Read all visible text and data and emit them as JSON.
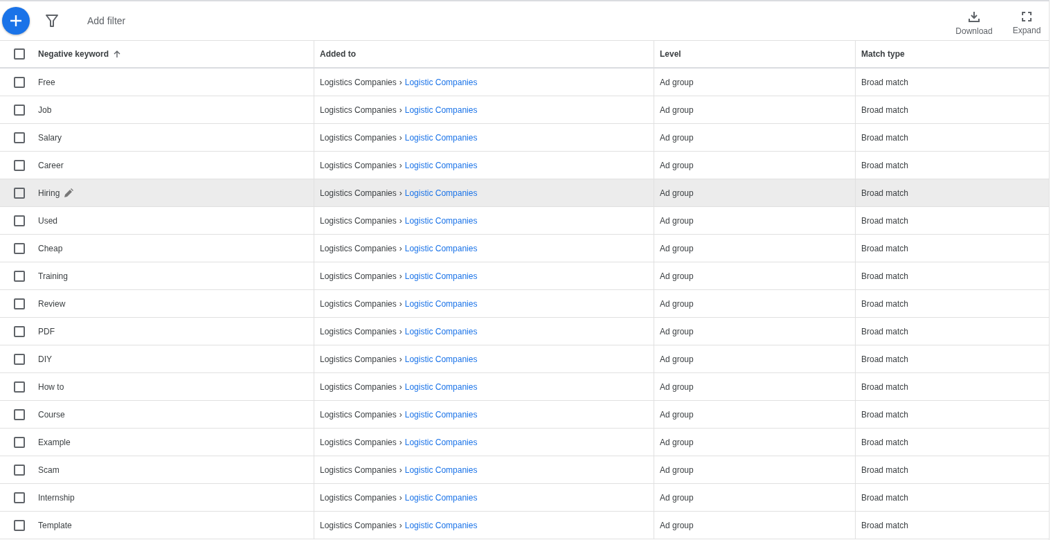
{
  "toolbar": {
    "add_filter": "Add filter",
    "actions": [
      {
        "kind": "download",
        "label": "Download"
      },
      {
        "kind": "expand",
        "label": "Expand"
      }
    ]
  },
  "table": {
    "columns": [
      {
        "label": "Negative keyword",
        "sorted": true
      },
      {
        "label": "Added to",
        "sorted": false
      },
      {
        "label": "Level",
        "sorted": false
      },
      {
        "label": "Match type",
        "sorted": false
      }
    ],
    "all_checked": false,
    "rows": [
      {
        "keyword": "Free",
        "campaign": "Logistics Companies",
        "separator": "›",
        "ad_group": "Logistic Companies",
        "level": "Ad group",
        "match_type": "Broad match",
        "checked": false,
        "hovered": false
      },
      {
        "keyword": "Job",
        "campaign": "Logistics Companies",
        "separator": "›",
        "ad_group": "Logistic Companies",
        "level": "Ad group",
        "match_type": "Broad match",
        "checked": false,
        "hovered": false
      },
      {
        "keyword": "Salary",
        "campaign": "Logistics Companies",
        "separator": "›",
        "ad_group": "Logistic Companies",
        "level": "Ad group",
        "match_type": "Broad match",
        "checked": false,
        "hovered": false
      },
      {
        "keyword": "Career",
        "campaign": "Logistics Companies",
        "separator": "›",
        "ad_group": "Logistic Companies",
        "level": "Ad group",
        "match_type": "Broad match",
        "checked": false,
        "hovered": false
      },
      {
        "keyword": "Hiring",
        "campaign": "Logistics Companies",
        "separator": "›",
        "ad_group": "Logistic Companies",
        "level": "Ad group",
        "match_type": "Broad match",
        "checked": false,
        "hovered": true
      },
      {
        "keyword": "Used",
        "campaign": "Logistics Companies",
        "separator": "›",
        "ad_group": "Logistic Companies",
        "level": "Ad group",
        "match_type": "Broad match",
        "checked": false,
        "hovered": false
      },
      {
        "keyword": "Cheap",
        "campaign": "Logistics Companies",
        "separator": "›",
        "ad_group": "Logistic Companies",
        "level": "Ad group",
        "match_type": "Broad match",
        "checked": false,
        "hovered": false
      },
      {
        "keyword": "Training",
        "campaign": "Logistics Companies",
        "separator": "›",
        "ad_group": "Logistic Companies",
        "level": "Ad group",
        "match_type": "Broad match",
        "checked": false,
        "hovered": false
      },
      {
        "keyword": "Review",
        "campaign": "Logistics Companies",
        "separator": "›",
        "ad_group": "Logistic Companies",
        "level": "Ad group",
        "match_type": "Broad match",
        "checked": false,
        "hovered": false
      },
      {
        "keyword": "PDF",
        "campaign": "Logistics Companies",
        "separator": "›",
        "ad_group": "Logistic Companies",
        "level": "Ad group",
        "match_type": "Broad match",
        "checked": false,
        "hovered": false
      },
      {
        "keyword": "DIY",
        "campaign": "Logistics Companies",
        "separator": "›",
        "ad_group": "Logistic Companies",
        "level": "Ad group",
        "match_type": "Broad match",
        "checked": false,
        "hovered": false
      },
      {
        "keyword": "How to",
        "campaign": "Logistics Companies",
        "separator": "›",
        "ad_group": "Logistic Companies",
        "level": "Ad group",
        "match_type": "Broad match",
        "checked": false,
        "hovered": false
      },
      {
        "keyword": "Course",
        "campaign": "Logistics Companies",
        "separator": "›",
        "ad_group": "Logistic Companies",
        "level": "Ad group",
        "match_type": "Broad match",
        "checked": false,
        "hovered": false
      },
      {
        "keyword": "Example",
        "campaign": "Logistics Companies",
        "separator": "›",
        "ad_group": "Logistic Companies",
        "level": "Ad group",
        "match_type": "Broad match",
        "checked": false,
        "hovered": false
      },
      {
        "keyword": "Scam",
        "campaign": "Logistics Companies",
        "separator": "›",
        "ad_group": "Logistic Companies",
        "level": "Ad group",
        "match_type": "Broad match",
        "checked": false,
        "hovered": false
      },
      {
        "keyword": "Internship",
        "campaign": "Logistics Companies",
        "separator": "›",
        "ad_group": "Logistic Companies",
        "level": "Ad group",
        "match_type": "Broad match",
        "checked": false,
        "hovered": false
      },
      {
        "keyword": "Template",
        "campaign": "Logistics Companies",
        "separator": "›",
        "ad_group": "Logistic Companies",
        "level": "Ad group",
        "match_type": "Broad match",
        "checked": false,
        "hovered": false
      }
    ]
  }
}
